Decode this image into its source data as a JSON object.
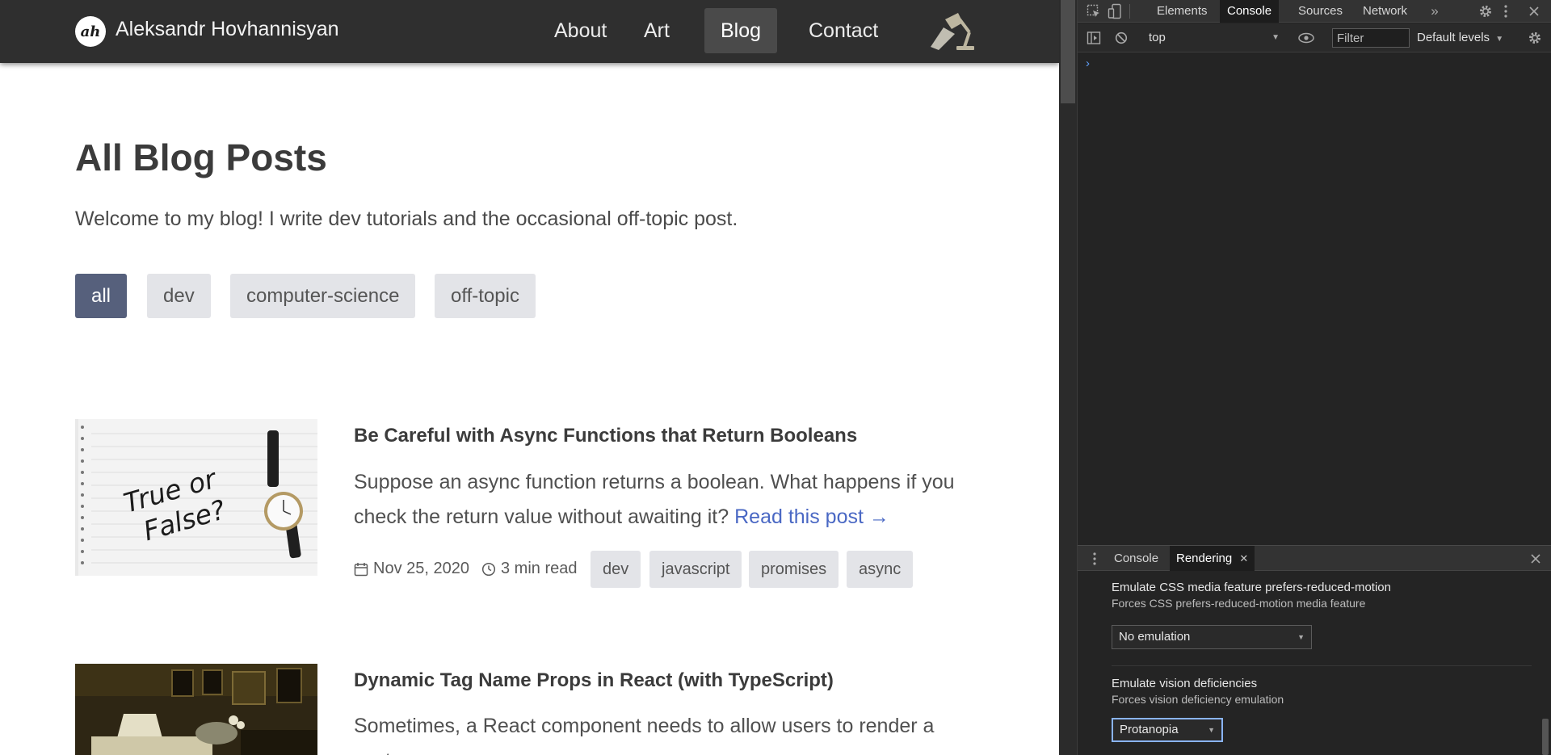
{
  "site": {
    "logo_text": "ah",
    "name": "Aleksandr Hovhannisyan",
    "nav": [
      {
        "label": "About"
      },
      {
        "label": "Art"
      },
      {
        "label": "Blog"
      },
      {
        "label": "Contact"
      }
    ],
    "active_nav": "Blog",
    "theme_toggle_icon": "desk-lamp-icon"
  },
  "page": {
    "title": "All Blog Posts",
    "intro": "Welcome to my blog! I write dev tutorials and the occasional off-topic post.",
    "categories": [
      "all",
      "dev",
      "computer-science",
      "off-topic"
    ],
    "active_category": "all"
  },
  "posts": [
    {
      "title": "Be Careful with Async Functions that Return Booleans",
      "description": "Suppose an async function returns a boolean. What happens if you check the return value without awaiting it?",
      "read_more": "Read this post →",
      "date": "Nov 25, 2020",
      "read_time": "3 min read",
      "tags": [
        "dev",
        "javascript",
        "promises",
        "async"
      ],
      "thumbnail_text": [
        "True or",
        "False?"
      ]
    },
    {
      "title": "Dynamic Tag Name Props in React (with TypeScript)",
      "description": "Sometimes, a React component needs to allow users to render a custom"
    }
  ],
  "devtools": {
    "tabs": [
      "Elements",
      "Console",
      "Sources",
      "Network"
    ],
    "active_tab": "Console",
    "more_tabs": "»",
    "context": "top",
    "filter_placeholder": "Filter",
    "levels": "Default levels",
    "prompt": "›",
    "drawer": {
      "tabs": [
        "Console",
        "Rendering"
      ],
      "active_tab": "Rendering",
      "close_tab": "✕",
      "sections": [
        {
          "title": "Emulate CSS media feature prefers-reduced-motion",
          "subtitle": "Forces CSS prefers-reduced-motion media feature",
          "value": "No emulation"
        },
        {
          "title": "Emulate vision deficiencies",
          "subtitle": "Forces vision deficiency emulation",
          "value": "Protanopia"
        }
      ]
    },
    "colors": {
      "accent": "#8ab4f8",
      "prompt": "#5f9df5",
      "link": "#4a68c4",
      "active_category_bg": "#56607c"
    }
  }
}
